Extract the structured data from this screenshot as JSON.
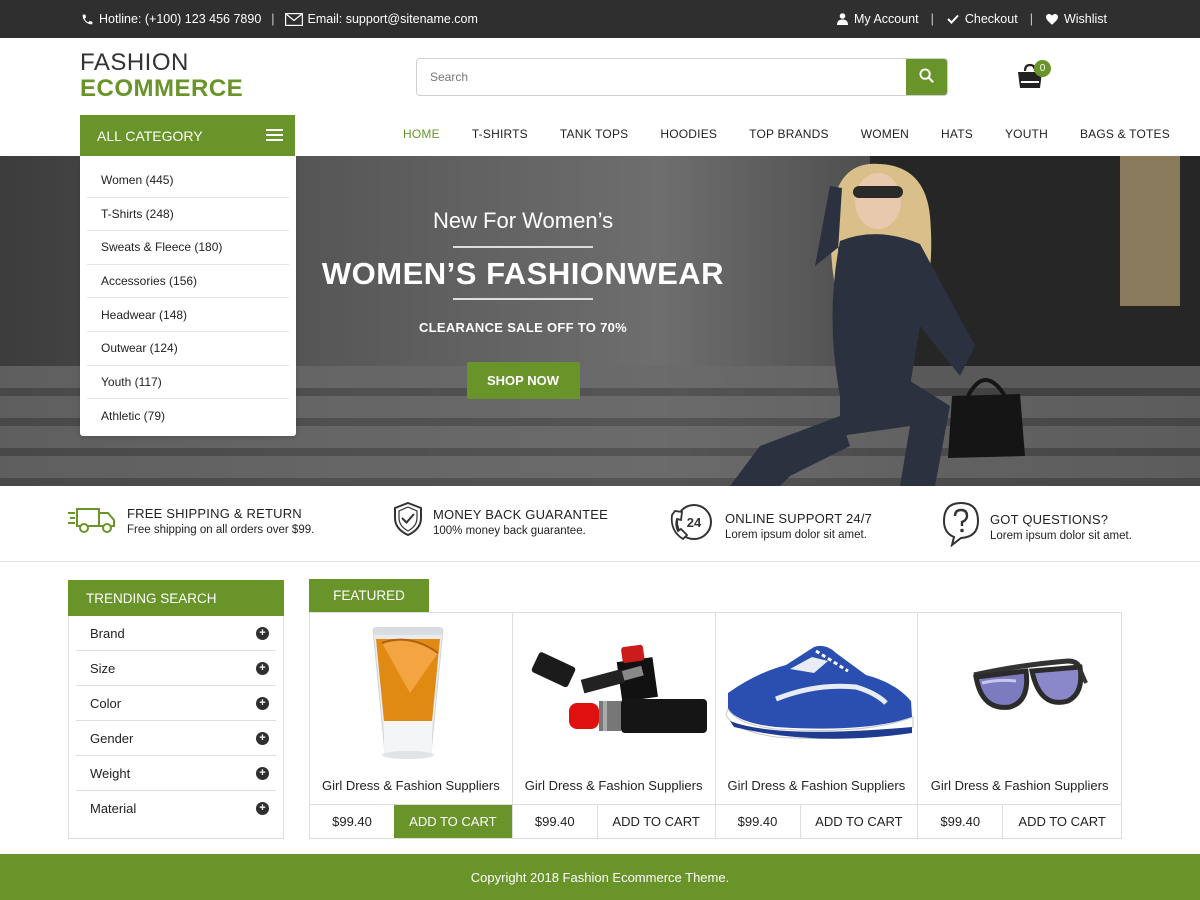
{
  "topbar": {
    "hotline": "Hotline: (+100) 123 456 7890",
    "email": "Email: support@sitename.com",
    "separator": "|",
    "my_account": "My Account",
    "checkout": "Checkout",
    "wishlist": "Wishlist"
  },
  "logo": {
    "line1": "FASHION",
    "line2": "ECOMMERCE"
  },
  "search": {
    "placeholder": "Search"
  },
  "cart": {
    "count": "0"
  },
  "nav": [
    "HOME",
    "T-SHIRTS",
    "TANK TOPS",
    "HOODIES",
    "TOP BRANDS",
    "WOMEN",
    "HATS",
    "YOUTH",
    "BAGS & TOTES"
  ],
  "category": {
    "title": "ALL CATEGORY",
    "items": [
      "Women (445)",
      "T-Shirts (248)",
      "Sweats & Fleece (180)",
      "Accessories (156)",
      "Headwear (148)",
      "Outwear (124)",
      "Youth (117)",
      "Athletic (79)"
    ]
  },
  "hero": {
    "subtitle": "New For Women’s",
    "title": "WOMEN’S FASHIONWEAR",
    "sale": "CLEARANCE SALE OFF TO 70%",
    "button": "SHOP NOW"
  },
  "features": [
    {
      "title": "FREE SHIPPING & RETURN",
      "desc": "Free shipping on all orders over $99.",
      "icon": "truck-icon"
    },
    {
      "title": "MONEY BACK GUARANTEE",
      "desc": "100% money back guarantee.",
      "icon": "shield-check-icon"
    },
    {
      "title": "ONLINE SUPPORT 24/7",
      "desc": "Lorem ipsum dolor sit amet.",
      "icon": "support-24-icon"
    },
    {
      "title": "GOT QUESTIONS?",
      "desc": "Lorem ipsum dolor sit amet.",
      "icon": "question-bubble-icon"
    }
  ],
  "trending": {
    "title": "TRENDING SEARCH",
    "items": [
      "Brand",
      "Size",
      "Color",
      "Gender",
      "Weight",
      "Material"
    ]
  },
  "featured": {
    "tab": "FEATURED",
    "products": [
      {
        "name": "Girl Dress & Fashion Suppliers",
        "price": "$99.40",
        "button": "ADD TO CART",
        "image": "shot-glass-image"
      },
      {
        "name": "Girl Dress & Fashion Suppliers",
        "price": "$99.40",
        "button": "ADD TO CART",
        "image": "lipstick-image"
      },
      {
        "name": "Girl Dress & Fashion Suppliers",
        "price": "$99.40",
        "button": "ADD TO CART",
        "image": "sneaker-image"
      },
      {
        "name": "Girl Dress & Fashion Suppliers",
        "price": "$99.40",
        "button": "ADD TO CART",
        "image": "sunglasses-image"
      }
    ]
  },
  "footer": {
    "copyright": "Copyright 2018 Fashion Ecommerce Theme."
  },
  "colors": {
    "accent": "#69942a",
    "topbar": "#2f2f2f"
  }
}
